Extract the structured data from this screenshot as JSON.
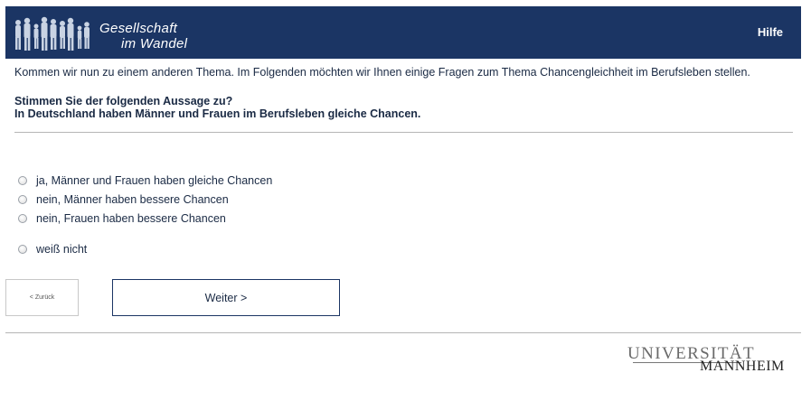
{
  "header": {
    "logo_line1": "Gesellschaft",
    "logo_line2": "im Wandel",
    "help_label": "Hilfe"
  },
  "intro_text": "Kommen wir nun zu einem anderen Thema. Im Folgenden möchten wir Ihnen einige Fragen zum Thema Chancengleichheit im Berufsleben stellen.",
  "question": {
    "line1": "Stimmen Sie der folgenden Aussage zu?",
    "line2": "In Deutschland haben Männer und Frauen im Berufsleben gleiche Chancen."
  },
  "options": [
    {
      "label": "ja, Männer und Frauen haben gleiche Chancen",
      "selected": false
    },
    {
      "label": "nein, Männer haben bessere Chancen",
      "selected": false
    },
    {
      "label": "nein, Frauen haben bessere Chancen",
      "selected": false
    },
    {
      "label": "weiß nicht",
      "selected": false
    }
  ],
  "nav": {
    "back_label": "< Zurück",
    "next_label": "Weiter >"
  },
  "footer": {
    "uni_line1": "UNIVERSITÄT",
    "uni_line2": "MANNHEIM"
  },
  "colors": {
    "header_bg": "#1b3564",
    "text": "#1a2a44"
  }
}
